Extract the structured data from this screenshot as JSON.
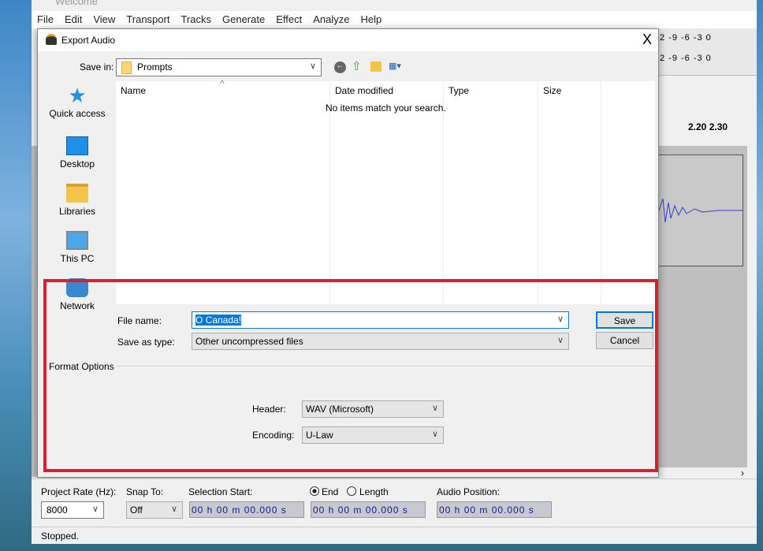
{
  "app": {
    "title": "Welcome",
    "menu": [
      "File",
      "Edit",
      "View",
      "Transport",
      "Tracks",
      "Generate",
      "Effect",
      "Analyze",
      "Help"
    ],
    "meter_ticks": "2 -9 -6 -3 0",
    "timeline_ticks": "2.20  2.30"
  },
  "dialog": {
    "title": "Export Audio",
    "close": "X",
    "save_in_label": "Save in:",
    "save_in_value": "Prompts",
    "nav": [
      "Quick access",
      "Desktop",
      "Libraries",
      "This PC",
      "Network"
    ],
    "columns": [
      "Name",
      "Date modified",
      "Type",
      "Size"
    ],
    "empty_message": "No items match your search.",
    "file_name_label": "File name:",
    "file_name_value": "O Canada!",
    "save_type_label": "Save as type:",
    "save_type_value": "Other uncompressed files",
    "save": "Save",
    "cancel": "Cancel",
    "format_options": "Format Options",
    "header_label": "Header:",
    "header_value": "WAV (Microsoft)",
    "encoding_label": "Encoding:",
    "encoding_value": "U-Law"
  },
  "toolbar": {
    "rate_label": "Project Rate (Hz):",
    "rate_value": "8000",
    "snap_label": "Snap To:",
    "snap_value": "Off",
    "sel_start_label": "Selection Start:",
    "end_label": "End",
    "length_label": "Length",
    "end_selected": true,
    "audio_pos_label": "Audio Position:",
    "time": "00 h 00 m 00.000 s"
  },
  "status": "Stopped.",
  "colors": {
    "highlight": "#e01b2a"
  }
}
